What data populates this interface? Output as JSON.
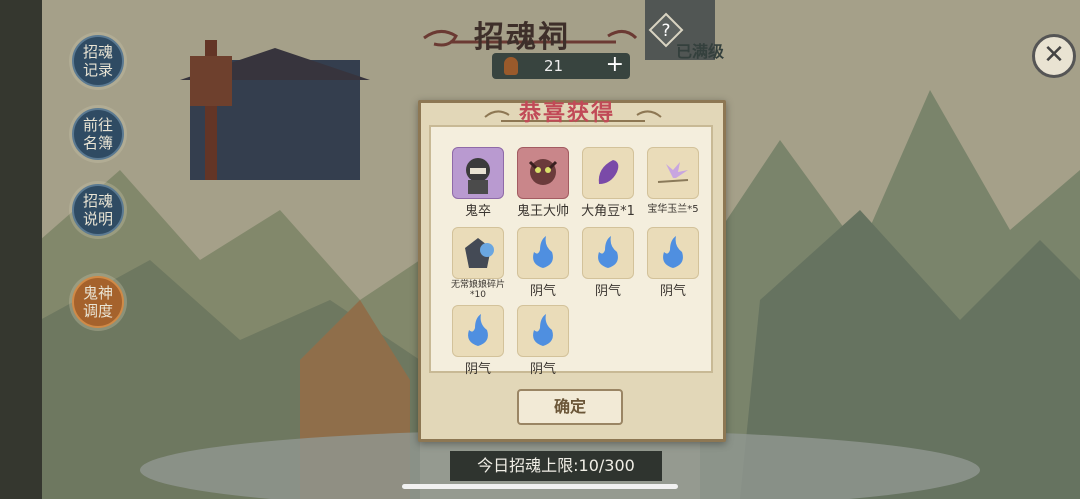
{
  "header": {
    "title": "招魂祠",
    "counter_value": "21",
    "counter_plus": "+",
    "help_symbol": "?",
    "max_level": "已满级",
    "close_symbol": "✕"
  },
  "sidebar": {
    "items": [
      {
        "label": "招魂记录"
      },
      {
        "label": "前往名簿"
      },
      {
        "label": "招魂说明"
      },
      {
        "label": "鬼神调度"
      }
    ]
  },
  "modal": {
    "title": "恭喜获得",
    "confirm_label": "确定",
    "items": [
      {
        "label": "鬼卒",
        "icon": "ghost-soldier-icon"
      },
      {
        "label": "鬼王大帅",
        "icon": "ghost-king-icon"
      },
      {
        "label": "大角豆*1",
        "icon": "bean-icon"
      },
      {
        "label": "宝华玉兰*5",
        "icon": "magnolia-icon"
      },
      {
        "label": "无常娘娘碎片*10",
        "icon": "fragment-icon"
      },
      {
        "label": "阴气",
        "icon": "yin-flame-icon"
      },
      {
        "label": "阴气",
        "icon": "yin-flame-icon"
      },
      {
        "label": "阴气",
        "icon": "yin-flame-icon"
      },
      {
        "label": "阴气",
        "icon": "yin-flame-icon"
      },
      {
        "label": "阴气",
        "icon": "yin-flame-icon"
      }
    ]
  },
  "footer": {
    "summon_limit": "今日招魂上限:10/300"
  },
  "colors": {
    "accent_title": "#c14a57",
    "panel": "#e2d7b8",
    "side_button": "#2f4b63"
  }
}
